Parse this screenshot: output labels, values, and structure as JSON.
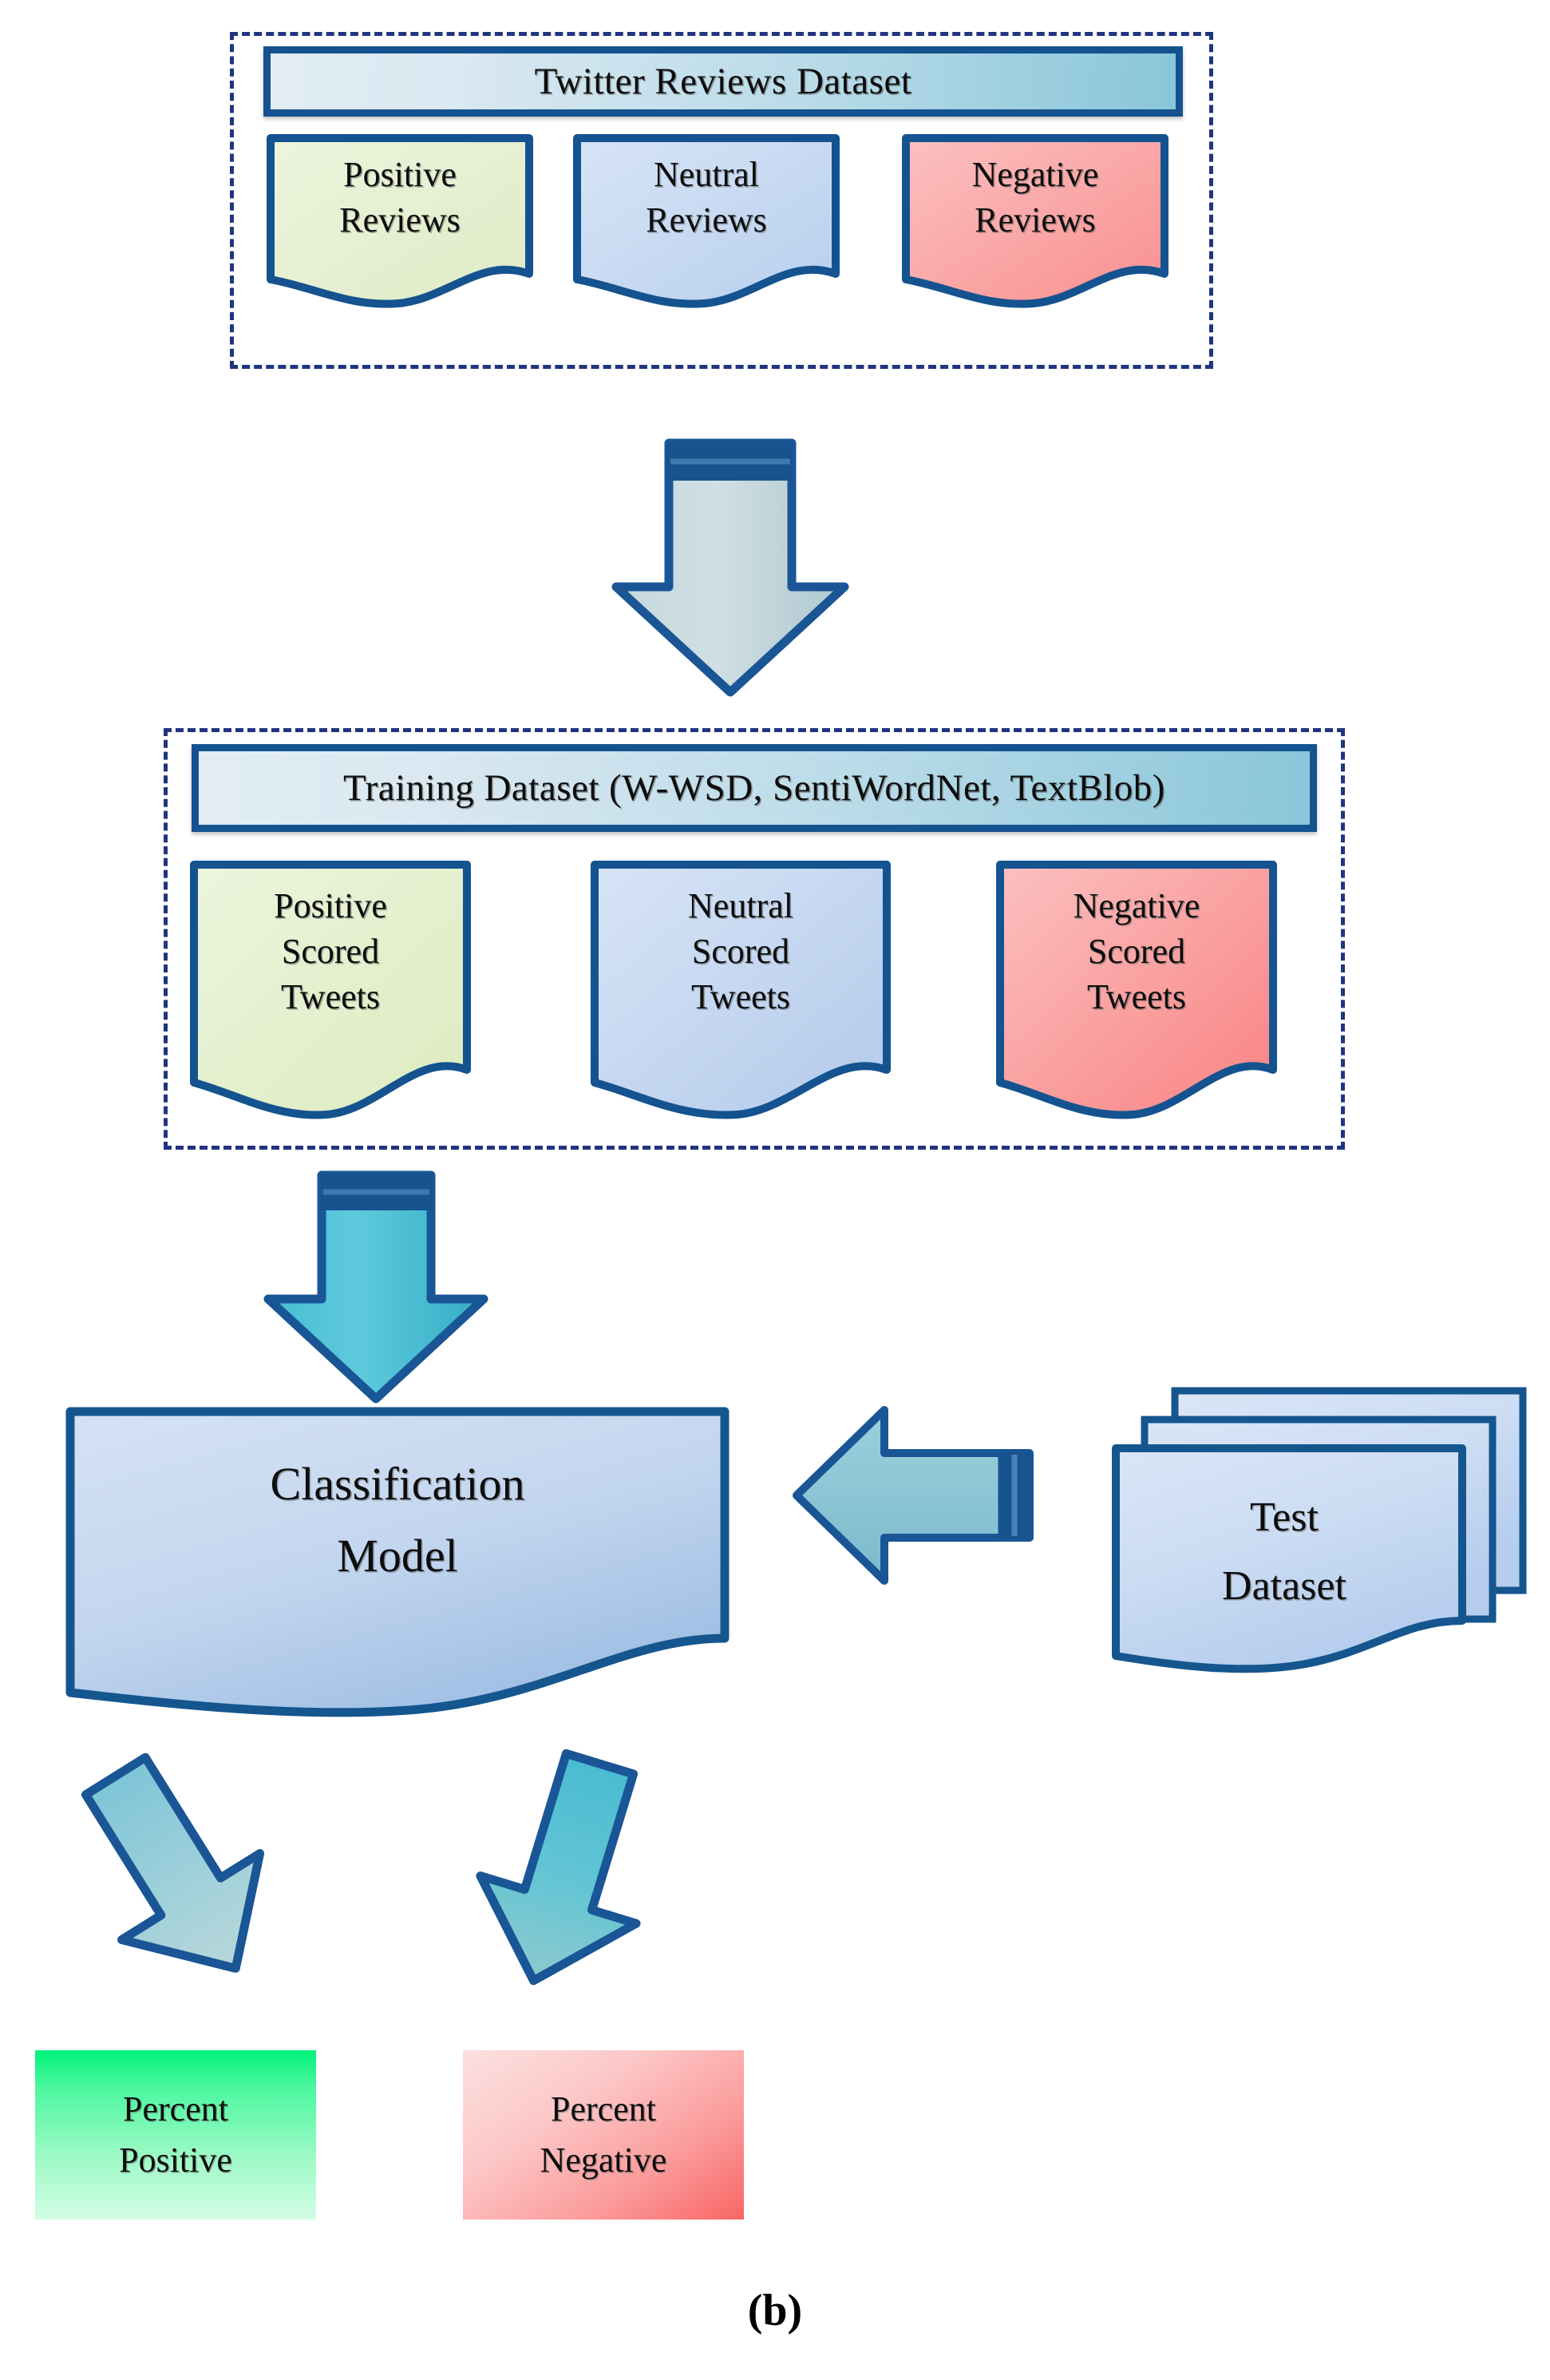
{
  "figure": {
    "caption": "(b)",
    "domain_label": "sentiment-analysis-pipeline-flowchart"
  },
  "colors": {
    "dashed_border": "#20357e",
    "box_border": "#14538f",
    "header_gradient_from": "#e2edf4",
    "header_gradient_to": "#89c6d9",
    "positive_fill": "#e6f0cf",
    "neutral_fill": "#cadcf2",
    "negative_fill": "#fba9a9",
    "model_fill": "#bed4ef",
    "test_fill": "#ccdcf2",
    "percent_positive_from": "#00f27a",
    "percent_positive_to": "#c8fbdb",
    "percent_negative_from": "#fcd8d8",
    "percent_negative_to": "#fb6b6b",
    "arrow_grey_blue": "#b9d0d6",
    "arrow_teal": "#4bbdd3",
    "arrow_light_teal": "#8fc9d6"
  },
  "stage1": {
    "group_name": "twitter-reviews-dataset-group",
    "header": "Twitter Reviews Dataset",
    "documents": [
      {
        "id": "positive-reviews",
        "lines": [
          "Positive",
          "Reviews"
        ],
        "fill": "#e6f0cf"
      },
      {
        "id": "neutral-reviews",
        "lines": [
          "Neutral",
          "Reviews"
        ],
        "fill": "#cadcf2"
      },
      {
        "id": "negative-reviews",
        "lines": [
          "Negative",
          "Reviews"
        ],
        "fill": "#fba9a9"
      }
    ]
  },
  "connector1": {
    "id": "arrow-dataset-to-training",
    "direction": "down",
    "style": "block-arrow"
  },
  "stage2": {
    "group_name": "training-dataset-group",
    "header": "Training Dataset (W-WSD, SentiWordNet, TextBlob)",
    "documents": [
      {
        "id": "positive-scored-tweets",
        "lines": [
          "Positive",
          "Scored",
          "Tweets"
        ],
        "fill": "#e6f0cf"
      },
      {
        "id": "neutral-scored-tweets",
        "lines": [
          "Neutral",
          "Scored",
          "Tweets"
        ],
        "fill": "#cadcf2"
      },
      {
        "id": "negative-scored-tweets",
        "lines": [
          "Negative",
          "Scored",
          "Tweets"
        ],
        "fill": "#fba9a9"
      }
    ]
  },
  "connector2": {
    "id": "arrow-training-to-model",
    "direction": "down",
    "style": "block-arrow"
  },
  "stage3": {
    "model": {
      "id": "classification-model",
      "lines": [
        "Classification",
        "Model"
      ]
    },
    "test": {
      "id": "test-dataset",
      "lines": [
        "Test",
        "Dataset"
      ],
      "stacked": 3
    },
    "connector": {
      "id": "arrow-test-to-model",
      "direction": "left",
      "style": "block-arrow"
    }
  },
  "connector3": {
    "id": "arrow-model-to-percent-positive",
    "direction": "down-left"
  },
  "connector4": {
    "id": "arrow-model-to-percent-negative",
    "direction": "down-right"
  },
  "stage4": {
    "outputs": [
      {
        "id": "percent-positive",
        "lines": [
          "Percent",
          "Positive"
        ]
      },
      {
        "id": "percent-negative",
        "lines": [
          "Percent",
          "Negative"
        ]
      }
    ]
  }
}
